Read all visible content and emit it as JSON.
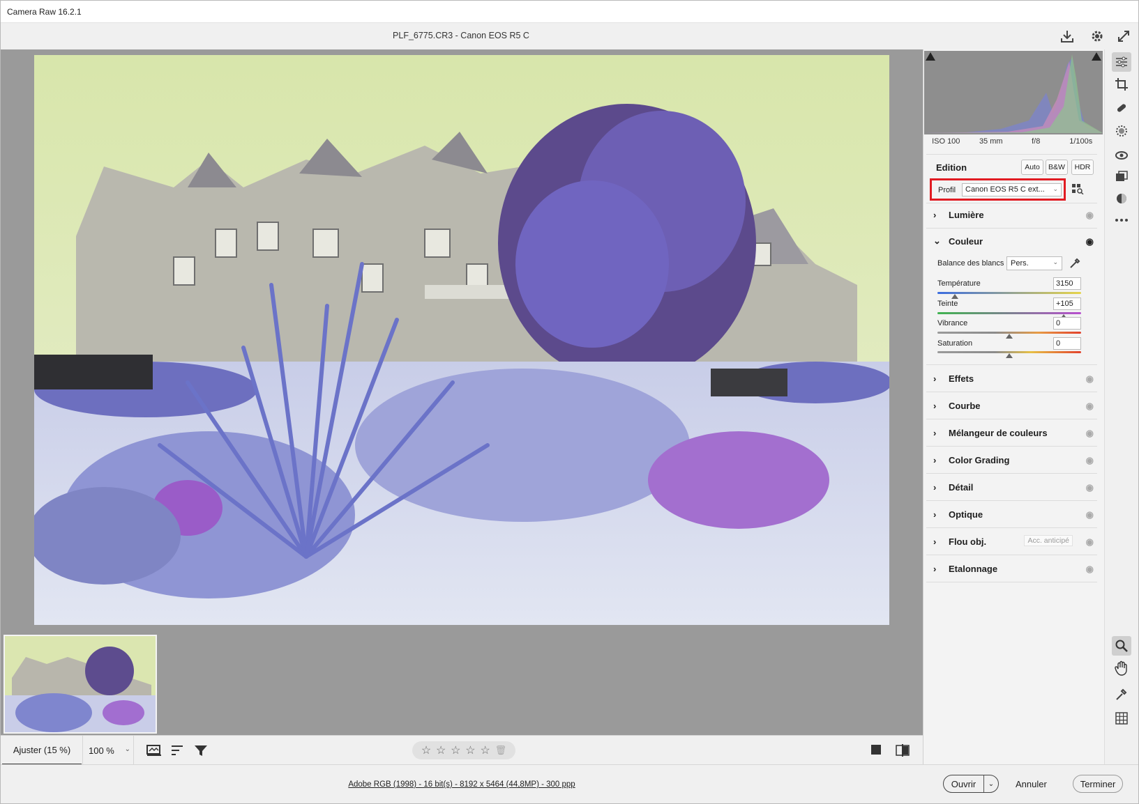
{
  "window": {
    "title": "Camera Raw 16.2.1"
  },
  "document": {
    "title": "PLF_6775.CR3  -  Canon EOS R5 C"
  },
  "top_actions": {
    "save_icon": "save-icon",
    "settings_icon": "gear-icon",
    "fullscreen_icon": "fullscreen-icon"
  },
  "histogram": {
    "iso": "ISO 100",
    "focal": "35 mm",
    "aperture": "f/8",
    "shutter": "1/100s"
  },
  "edit": {
    "title": "Edition",
    "buttons": [
      "Auto",
      "B&W",
      "HDR"
    ],
    "profile_label": "Profil",
    "profile_value": "Canon EOS R5 C ext...",
    "highlight_color": "#e11b22"
  },
  "sections": {
    "light": "Lumière",
    "color": "Couleur",
    "effects": "Effets",
    "curve": "Courbe",
    "mixer": "Mélangeur de couleurs",
    "grading": "Color Grading",
    "detail": "Détail",
    "optics": "Optique",
    "blur": "Flou obj.",
    "blur_tag": "Acc. anticipé",
    "calibration": "Etalonnage"
  },
  "color_panel": {
    "wb_label": "Balance des blancs",
    "wb_value": "Pers.",
    "sliders": [
      {
        "label": "Température",
        "value": "3150",
        "position": 0.12
      },
      {
        "label": "Teinte",
        "value": "+105",
        "position": 0.88
      },
      {
        "label": "Vibrance",
        "value": "0",
        "position": 0.5
      },
      {
        "label": "Saturation",
        "value": "0",
        "position": 0.5
      }
    ]
  },
  "toolbar": {
    "fit_label": "Ajuster (15 %)",
    "zoom_value": "100 %",
    "rating_stars": 5,
    "star_glyph": "☆"
  },
  "status": {
    "info_link": "Adobe RGB (1998) - 16 bit(s) - 8192 x 5464 (44,8MP) - 300 ppp",
    "open": "Ouvrir",
    "cancel": "Annuler",
    "done": "Terminer"
  }
}
